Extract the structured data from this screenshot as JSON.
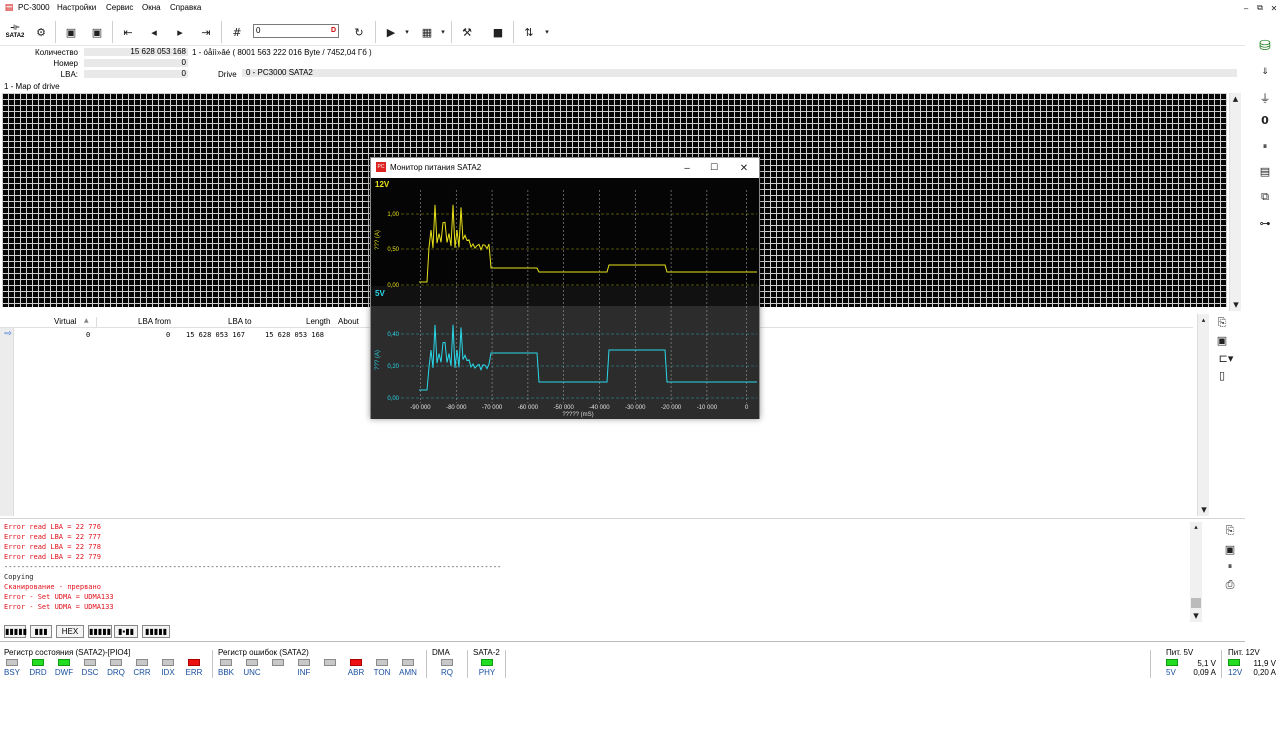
{
  "app": {
    "title": "PC-3000"
  },
  "menu": [
    "Настройки",
    "Сервис",
    "Окна",
    "Справка"
  ],
  "toolbar": {
    "sata_label": "SATA2",
    "lba_input_value": "0",
    "lba_input_suffix": "D"
  },
  "info": {
    "count_label": "Количество",
    "count_value": "15 628 053 168",
    "count_extra": "1 - óåìì»âé  ( 8001 563 222 016 Byte /  7452,04 Гб )",
    "number_label": "Номер",
    "number_value": "0",
    "lba_label": "LBA:",
    "lba_value": "0",
    "drive_label": "Drive",
    "drive_value": "0 - PC3000 SATA2"
  },
  "map": {
    "label": "1 - Map of drive"
  },
  "table": {
    "headers": [
      "Virtual",
      "LBA from",
      "LBA to",
      "Length",
      "About"
    ],
    "row": {
      "virtual": "0",
      "lba_from": "0",
      "lba_to": "15 628 053 167",
      "length": "15 628 053 168"
    }
  },
  "log": [
    {
      "text": "Error read LBA =      22 776",
      "color": "red"
    },
    {
      "text": "Error read LBA =      22 777",
      "color": "red"
    },
    {
      "text": "Error read LBA =      22 778",
      "color": "red"
    },
    {
      "text": "Error read LBA =      22 779",
      "color": "red"
    },
    {
      "text": "----------------------------------------------------------------------------------------------------------------------",
      "color": "black"
    },
    {
      "text": "Copying",
      "color": "black"
    },
    {
      "text": "Сканирование - прервано",
      "color": "red"
    },
    {
      "text": "Error - Set UDMA = UDMA133",
      "color": "red"
    },
    {
      "text": "Error - Set UDMA = UDMA133",
      "color": "red"
    }
  ],
  "tabs": [
    "▮▮▮▮▮",
    "▮▮▮",
    "HEX",
    "▮▮▮▮▮",
    "▮▪▮▮",
    "▮▮▮▮▮"
  ],
  "status_register": {
    "title": "Регистр состояния (SATA2)-[PIO4]",
    "items": [
      {
        "label": "BSY",
        "state": "off"
      },
      {
        "label": "DRD",
        "state": "on"
      },
      {
        "label": "DWF",
        "state": "on"
      },
      {
        "label": "DSC",
        "state": "off"
      },
      {
        "label": "DRQ",
        "state": "off"
      },
      {
        "label": "CRR",
        "state": "off"
      },
      {
        "label": "IDX",
        "state": "off"
      },
      {
        "label": "ERR",
        "state": "err"
      }
    ]
  },
  "error_register": {
    "title": "Регистр ошибок  (SATA2)",
    "items": [
      {
        "label": "BBK",
        "state": "off"
      },
      {
        "label": "UNC",
        "state": "off"
      },
      {
        "label": "",
        "state": "off"
      },
      {
        "label": "INF",
        "state": "off"
      },
      {
        "label": "",
        "state": "off"
      },
      {
        "label": "ABR",
        "state": "err"
      },
      {
        "label": "TON",
        "state": "off"
      },
      {
        "label": "AMN",
        "state": "off"
      }
    ]
  },
  "dma": {
    "title": "DMA",
    "items": [
      {
        "label": "RQ",
        "state": "off"
      }
    ]
  },
  "sata2": {
    "title": "SATA-2",
    "items": [
      {
        "label": "PHY",
        "state": "on"
      }
    ]
  },
  "power": {
    "p5_title": "Пит. 5V",
    "p5_label": "5V",
    "p5_voltage": "5,1 V",
    "p5_current": "0,09 A",
    "p12_title": "Пит. 12V",
    "p12_label": "12V",
    "p12_voltage": "11,9 V",
    "p12_current": "0,20 A"
  },
  "power_monitor": {
    "title": "Монитор питания SATA2",
    "top_label": "12V",
    "bottom_label": "5V",
    "top_ylabel": "??? (A)",
    "bottom_ylabel": "??? (A)",
    "xlabel": "????? (mS)",
    "top_ticks": [
      "1,00",
      "0,50",
      "0,00"
    ],
    "bottom_ticks": [
      "0,40",
      "0,20",
      "0,00"
    ],
    "x_ticks": [
      "-90 000",
      "-80 000",
      "-70 000",
      "-60 000",
      "-50 000",
      "-40 000",
      "-30 000",
      "-20 000",
      "-10 000",
      "0"
    ]
  },
  "colors": {
    "trace_12v": "#e8e21a",
    "trace_5v": "#2ad7e8",
    "led_on": "#22dd22",
    "led_err": "#ee1111"
  }
}
